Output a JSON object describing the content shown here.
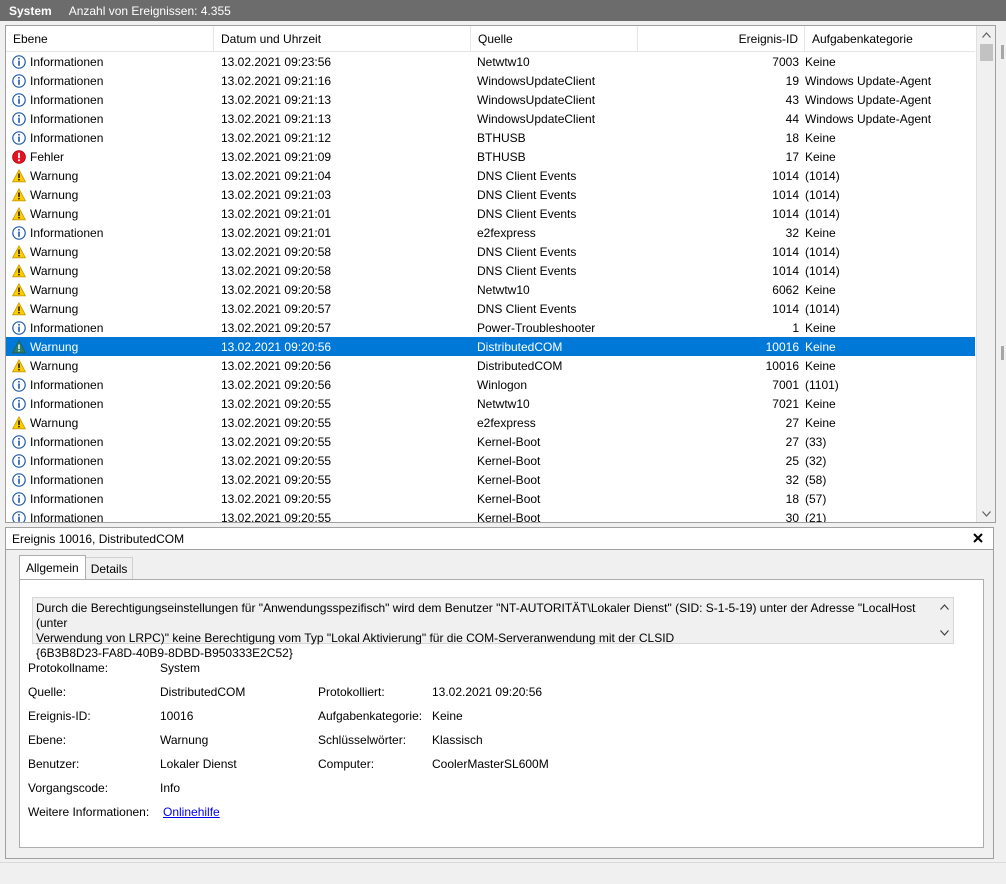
{
  "titlebar": {
    "name": "System",
    "count": "Anzahl von Ereignissen: 4.355"
  },
  "columns": {
    "level": "Ebene",
    "datetime": "Datum und Uhrzeit",
    "source": "Quelle",
    "event_id": "Ereignis-ID",
    "category": "Aufgabenkategorie"
  },
  "events": [
    {
      "level": "Informationen",
      "icon": "info-icon",
      "datetime": "13.02.2021 09:23:56",
      "source": "Netwtw10",
      "event_id": "7003",
      "category": "Keine"
    },
    {
      "level": "Informationen",
      "icon": "info-icon",
      "datetime": "13.02.2021 09:21:16",
      "source": "WindowsUpdateClient",
      "event_id": "19",
      "category": "Windows Update-Agent"
    },
    {
      "level": "Informationen",
      "icon": "info-icon",
      "datetime": "13.02.2021 09:21:13",
      "source": "WindowsUpdateClient",
      "event_id": "43",
      "category": "Windows Update-Agent"
    },
    {
      "level": "Informationen",
      "icon": "info-icon",
      "datetime": "13.02.2021 09:21:13",
      "source": "WindowsUpdateClient",
      "event_id": "44",
      "category": "Windows Update-Agent"
    },
    {
      "level": "Informationen",
      "icon": "info-icon",
      "datetime": "13.02.2021 09:21:12",
      "source": "BTHUSB",
      "event_id": "18",
      "category": "Keine"
    },
    {
      "level": "Fehler",
      "icon": "error-icon",
      "datetime": "13.02.2021 09:21:09",
      "source": "BTHUSB",
      "event_id": "17",
      "category": "Keine"
    },
    {
      "level": "Warnung",
      "icon": "warning-icon",
      "datetime": "13.02.2021 09:21:04",
      "source": "DNS Client Events",
      "event_id": "1014",
      "category": "(1014)"
    },
    {
      "level": "Warnung",
      "icon": "warning-icon",
      "datetime": "13.02.2021 09:21:03",
      "source": "DNS Client Events",
      "event_id": "1014",
      "category": "(1014)"
    },
    {
      "level": "Warnung",
      "icon": "warning-icon",
      "datetime": "13.02.2021 09:21:01",
      "source": "DNS Client Events",
      "event_id": "1014",
      "category": "(1014)"
    },
    {
      "level": "Informationen",
      "icon": "info-icon",
      "datetime": "13.02.2021 09:21:01",
      "source": "e2fexpress",
      "event_id": "32",
      "category": "Keine"
    },
    {
      "level": "Warnung",
      "icon": "warning-icon",
      "datetime": "13.02.2021 09:20:58",
      "source": "DNS Client Events",
      "event_id": "1014",
      "category": "(1014)"
    },
    {
      "level": "Warnung",
      "icon": "warning-icon",
      "datetime": "13.02.2021 09:20:58",
      "source": "DNS Client Events",
      "event_id": "1014",
      "category": "(1014)"
    },
    {
      "level": "Warnung",
      "icon": "warning-icon",
      "datetime": "13.02.2021 09:20:58",
      "source": "Netwtw10",
      "event_id": "6062",
      "category": "Keine"
    },
    {
      "level": "Warnung",
      "icon": "warning-icon",
      "datetime": "13.02.2021 09:20:57",
      "source": "DNS Client Events",
      "event_id": "1014",
      "category": "(1014)"
    },
    {
      "level": "Informationen",
      "icon": "info-icon",
      "datetime": "13.02.2021 09:20:57",
      "source": "Power-Troubleshooter",
      "event_id": "1",
      "category": "Keine"
    },
    {
      "level": "Warnung",
      "icon": "warning-icon",
      "datetime": "13.02.2021 09:20:56",
      "source": "DistributedCOM",
      "event_id": "10016",
      "category": "Keine",
      "selected": true
    },
    {
      "level": "Warnung",
      "icon": "warning-icon",
      "datetime": "13.02.2021 09:20:56",
      "source": "DistributedCOM",
      "event_id": "10016",
      "category": "Keine"
    },
    {
      "level": "Informationen",
      "icon": "info-icon",
      "datetime": "13.02.2021 09:20:56",
      "source": "Winlogon",
      "event_id": "7001",
      "category": "(1101)"
    },
    {
      "level": "Informationen",
      "icon": "info-icon",
      "datetime": "13.02.2021 09:20:55",
      "source": "Netwtw10",
      "event_id": "7021",
      "category": "Keine"
    },
    {
      "level": "Warnung",
      "icon": "warning-icon",
      "datetime": "13.02.2021 09:20:55",
      "source": "e2fexpress",
      "event_id": "27",
      "category": "Keine"
    },
    {
      "level": "Informationen",
      "icon": "info-icon",
      "datetime": "13.02.2021 09:20:55",
      "source": "Kernel-Boot",
      "event_id": "27",
      "category": "(33)"
    },
    {
      "level": "Informationen",
      "icon": "info-icon",
      "datetime": "13.02.2021 09:20:55",
      "source": "Kernel-Boot",
      "event_id": "25",
      "category": "(32)"
    },
    {
      "level": "Informationen",
      "icon": "info-icon",
      "datetime": "13.02.2021 09:20:55",
      "source": "Kernel-Boot",
      "event_id": "32",
      "category": "(58)"
    },
    {
      "level": "Informationen",
      "icon": "info-icon",
      "datetime": "13.02.2021 09:20:55",
      "source": "Kernel-Boot",
      "event_id": "18",
      "category": "(57)"
    },
    {
      "level": "Informationen",
      "icon": "info-icon",
      "datetime": "13.02.2021 09:20:55",
      "source": "Kernel-Boot",
      "event_id": "30",
      "category": "(21)"
    }
  ],
  "detail": {
    "title": "Ereignis 10016, DistributedCOM",
    "tabs": {
      "general": "Allgemein",
      "details": "Details"
    },
    "message_lines": [
      "Durch die Berechtigungseinstellungen für \"Anwendungsspezifisch\" wird dem Benutzer \"NT-AUTORITÄT\\Lokaler Dienst\" (SID: S-1-5-19) unter der Adresse \"LocalHost (unter",
      "Verwendung von LRPC)\" keine Berechtigung vom Typ \"Lokal Aktivierung\" für die COM-Serveranwendung mit der CLSID",
      "{6B3B8D23-FA8D-40B9-8DBD-B950333E2C52}"
    ],
    "fields": {
      "log_label": "Protokollname:",
      "log_value": "System",
      "source_label": "Quelle:",
      "source_value": "DistributedCOM",
      "logged_label": "Protokolliert:",
      "logged_value": "13.02.2021 09:20:56",
      "eventid_label": "Ereignis-ID:",
      "eventid_value": "10016",
      "category_label": "Aufgabenkategorie:",
      "category_value": "Keine",
      "level_label": "Ebene:",
      "level_value": "Warnung",
      "keywords_label": "Schlüsselwörter:",
      "keywords_value": "Klassisch",
      "user_label": "Benutzer:",
      "user_value": "Lokaler Dienst",
      "computer_label": "Computer:",
      "computer_value": "CoolerMasterSL600M",
      "opcode_label": "Vorgangscode:",
      "opcode_value": "Info",
      "moreinfo_label": "Weitere Informationen:",
      "moreinfo_link": "Onlinehilfe"
    }
  },
  "colors": {
    "selection": "#0078d7",
    "titlebar": "#6c6c6c",
    "info": "#1d5aa8",
    "warning": "#ffcc00",
    "error": "#e81123"
  }
}
